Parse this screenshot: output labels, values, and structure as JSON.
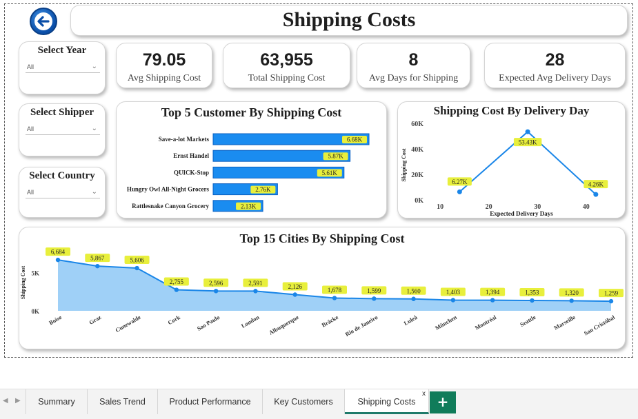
{
  "page_title": "Shipping Costs",
  "slicers": {
    "year": {
      "title": "Select Year",
      "value": "All"
    },
    "shipper": {
      "title": "Select Shipper",
      "value": "All"
    },
    "country": {
      "title": "Select Country",
      "value": "All"
    }
  },
  "kpis": {
    "avg_shipping_cost": {
      "value": "79.05",
      "label": "Avg Shipping Cost"
    },
    "total_shipping_cost": {
      "value": "63,955",
      "label": "Total Shipping Cost"
    },
    "avg_days_shipping": {
      "value": "8",
      "label": "Avg Days for Shipping"
    },
    "expected_avg_delivery": {
      "value": "28",
      "label": "Expected Avg Delivery Days"
    }
  },
  "colors": {
    "bar": "#1a8cf0",
    "bar_dark": "#0b5fc0",
    "label_bg": "#e8ef3c",
    "area_fill": "#9fd0f7",
    "line": "#1a86e8",
    "tab_accent": "#107c5a"
  },
  "chart_data": [
    {
      "id": "top_customers",
      "type": "bar",
      "orientation": "horizontal",
      "title": "Top 5 Customer By Shipping Cost",
      "categories": [
        "Save-a-lot Markets",
        "Ernst Handel",
        "QUICK-Stop",
        "Hungry Owl All-Night Grocers",
        "Rattlesnake Canyon Grocery"
      ],
      "values": [
        6680,
        5870,
        5610,
        2760,
        2130
      ],
      "data_labels": [
        "6.68K",
        "5.87K",
        "5.61K",
        "2.76K",
        "2.13K"
      ]
    },
    {
      "id": "delivery_day",
      "type": "line",
      "title": "Shipping Cost By Delivery Day",
      "xlabel": "Expected Delivery Days",
      "ylabel": "Shipping Cost",
      "x": [
        14,
        28,
        42
      ],
      "values": [
        6270,
        53430,
        4260
      ],
      "data_labels": [
        "6.27K",
        "53.43K",
        "4.26K"
      ],
      "xlim": [
        7,
        45
      ],
      "ylim": [
        0,
        60000
      ],
      "x_ticks": [
        10,
        20,
        30,
        40
      ],
      "x_tick_labels": [
        "10",
        "20",
        "30",
        "40"
      ],
      "y_ticks": [
        0,
        20000,
        40000,
        60000
      ],
      "y_tick_labels": [
        "0K",
        "20K",
        "40K",
        "60K"
      ]
    },
    {
      "id": "top_cities",
      "type": "area",
      "title": "Top 15 Cities By Shipping Cost",
      "ylabel": "Shipping Cost",
      "categories": [
        "Boise",
        "Graz",
        "Cunewalde",
        "Cork",
        "Sao Paulo",
        "London",
        "Albuquerque",
        "Bräcke",
        "Rio de Janeiro",
        "Luleå",
        "München",
        "Montréal",
        "Seattle",
        "Marseille",
        "San Cristóbal"
      ],
      "values": [
        6684,
        5867,
        5606,
        2755,
        2596,
        2591,
        2126,
        1678,
        1599,
        1560,
        1403,
        1394,
        1353,
        1320,
        1259
      ],
      "data_labels": [
        "6,684",
        "5,867",
        "5,606",
        "2,755",
        "2,596",
        "2,591",
        "2,126",
        "1,678",
        "1,599",
        "1,560",
        "1,403",
        "1,394",
        "1,353",
        "1,320",
        "1,259"
      ],
      "ylim": [
        0,
        7600
      ],
      "y_ticks": [
        0,
        5000
      ],
      "y_tick_labels": [
        "0K",
        "5K"
      ]
    }
  ],
  "tabs": {
    "items": [
      {
        "label": "Summary"
      },
      {
        "label": "Sales Trend"
      },
      {
        "label": "Product Performance"
      },
      {
        "label": "Key Customers"
      },
      {
        "label": "Shipping Costs"
      }
    ],
    "active": "Shipping Costs",
    "close_glyph": "x",
    "add_glyph": "+",
    "prev_glyph": "◀",
    "next_glyph": "▶"
  }
}
